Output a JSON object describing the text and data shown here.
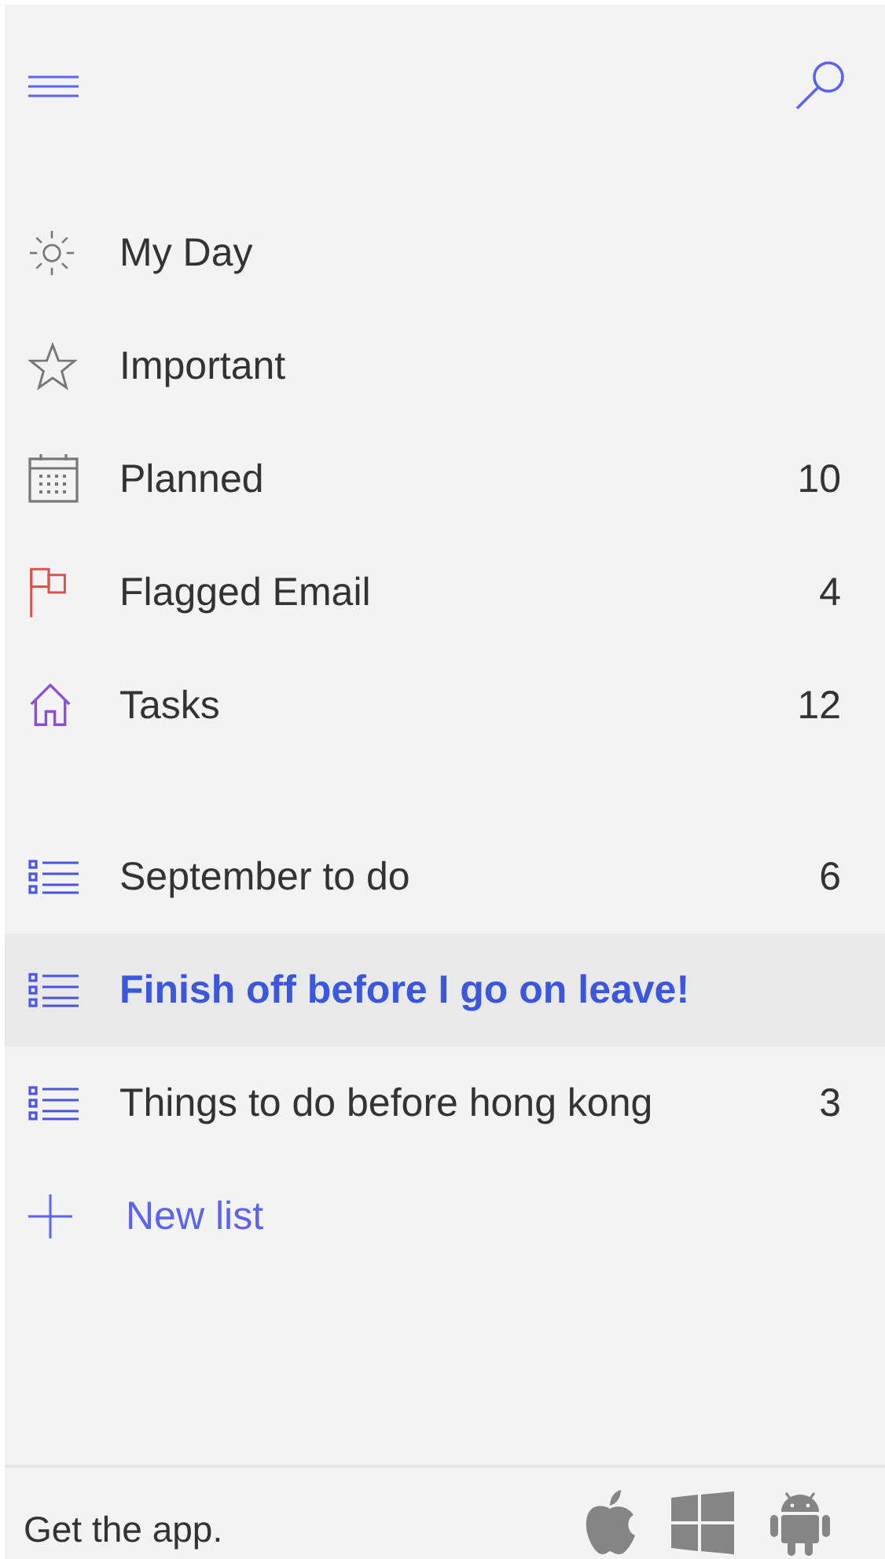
{
  "smart_lists": [
    {
      "kind": "sun",
      "label": "My Day"
    },
    {
      "kind": "star",
      "label": "Important"
    },
    {
      "kind": "calendar",
      "label": "Planned",
      "count": "10"
    },
    {
      "kind": "flag",
      "label": "Flagged Email",
      "count": "4"
    },
    {
      "kind": "home",
      "label": "Tasks",
      "count": "12"
    }
  ],
  "lists": [
    {
      "label": "September to do",
      "count": "6",
      "selected": false
    },
    {
      "label": "Finish off before I go on leave!",
      "selected": true
    },
    {
      "label": "Things to do before hong kong",
      "count": "3",
      "selected": false
    }
  ],
  "new_list": {
    "label": "New list"
  },
  "footer": {
    "text": "Get the app."
  }
}
